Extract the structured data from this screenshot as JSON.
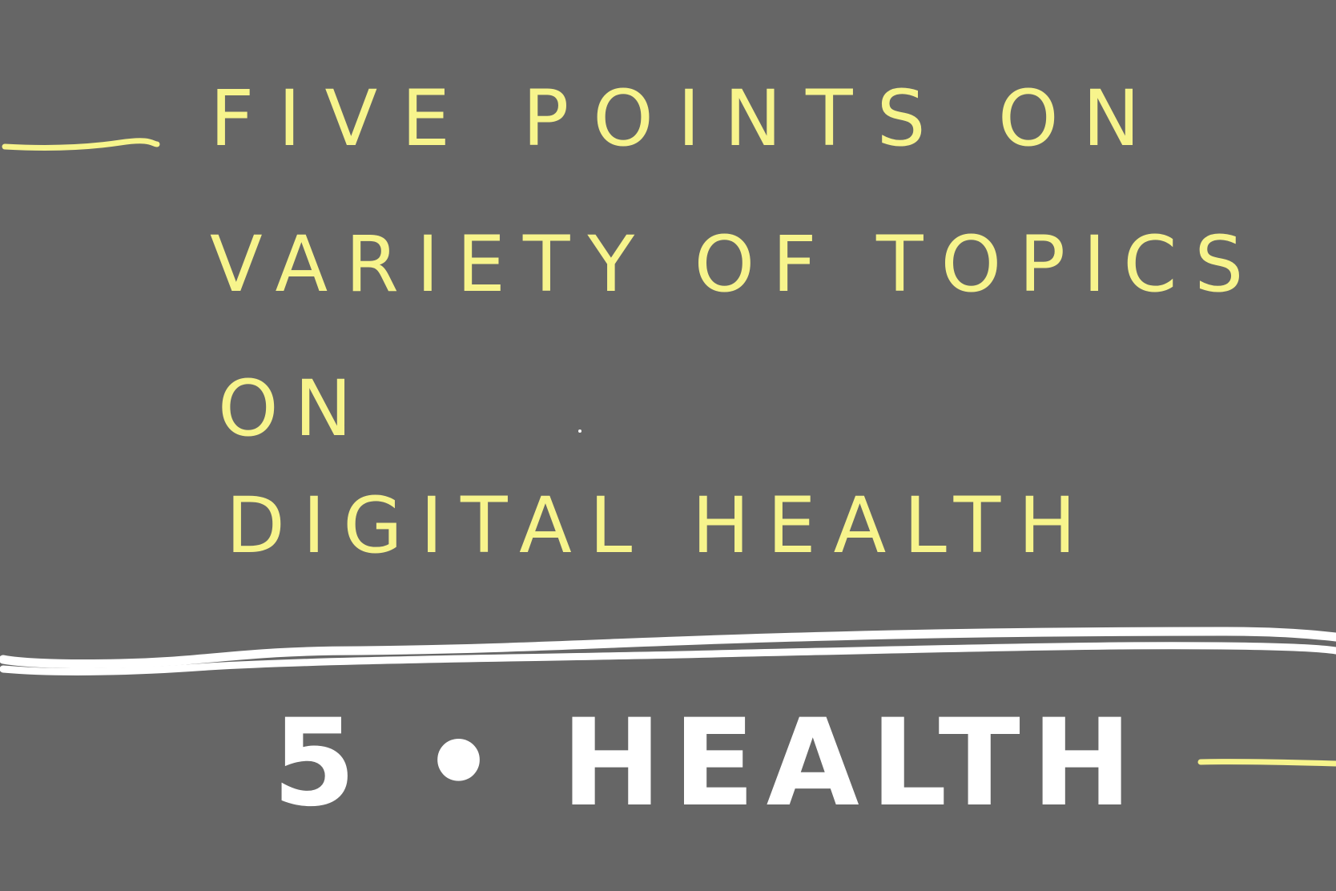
{
  "note_lines": [
    "FIVE POINTS ON",
    "VARIETY OF TOPICS",
    "ON",
    "DIGITAL HEALTH"
  ],
  "heading": "5 • HEALTH",
  "colors": {
    "background": "#666666",
    "yellow_ink": "#F7F48C",
    "white_ink": "#FFFFFF"
  }
}
